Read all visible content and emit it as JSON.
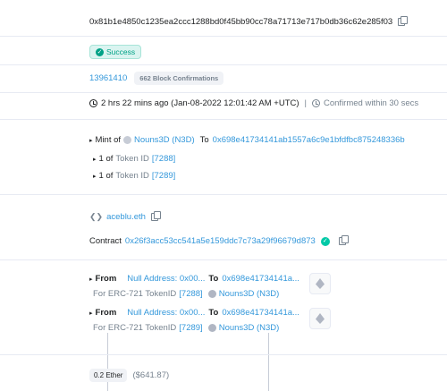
{
  "tx": {
    "hash": "0x81b1e4850c1235ea2ccc1288bd0f45bb90cc78a71713e717b0db36c62e285f03",
    "status": "Success",
    "block": "13961410",
    "confirmations": "662 Block Confirmations",
    "timestamp": "2 hrs 22 mins ago (Jan-08-2022 12:01:42 AM +UTC)",
    "separator": "|",
    "confirmed_within": "Confirmed within 30 secs"
  },
  "action": {
    "mint_label": "Mint of",
    "collection": "Nouns3D (N3D)",
    "to_label": "To",
    "to_address": "0x698e41734141ab1557a6c9e1bfdfbc875248336b",
    "tokens": [
      {
        "qty": "1 of",
        "label": "Token ID",
        "id": "[7288]"
      },
      {
        "qty": "1 of",
        "label": "Token ID",
        "id": "[7289]"
      }
    ]
  },
  "from": {
    "ens": "aceblu.eth"
  },
  "interacted": {
    "label": "Contract",
    "address": "0x26f3acc53cc541a5e159ddc7c73a29f96679d873"
  },
  "transfers": [
    {
      "from_label": "From",
      "from_value": "Null Address: 0x00...",
      "to_label": "To",
      "to_value": "0x698e41734141a...",
      "for_label": "For ERC-721 TokenID",
      "token_id": "[7288]",
      "collection": "Nouns3D (N3D)"
    },
    {
      "from_label": "From",
      "from_value": "Null Address: 0x00...",
      "to_label": "To",
      "to_value": "0x698e41734141a...",
      "for_label": "For ERC-721 TokenID",
      "token_id": "[7289]",
      "collection": "Nouns3D (N3D)"
    }
  ],
  "value": {
    "amount": "0.2 Ether",
    "usd": "($641.87)"
  }
}
